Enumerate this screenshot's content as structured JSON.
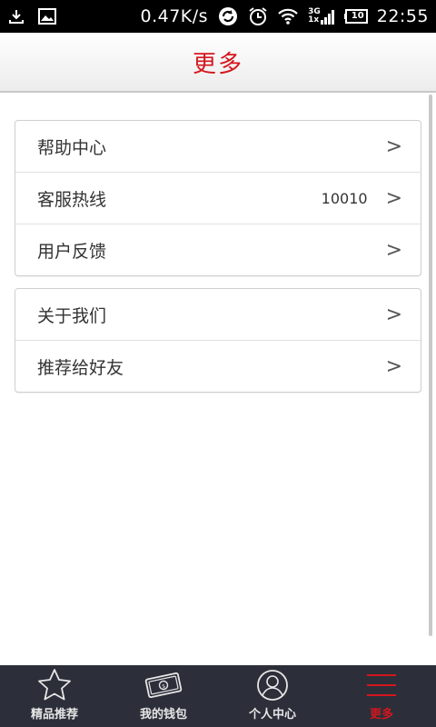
{
  "statusbar": {
    "speed": "0.47K/s",
    "network": "3G",
    "network_sub": "1x",
    "battery": "10",
    "time": "22:55"
  },
  "header": {
    "title": "更多"
  },
  "groups": [
    {
      "items": [
        {
          "label": "帮助中心",
          "value": "",
          "arrow": ">"
        },
        {
          "label": "客服热线",
          "value": "10010",
          "arrow": ">"
        },
        {
          "label": "用户反馈",
          "value": "",
          "arrow": ">"
        }
      ]
    },
    {
      "items": [
        {
          "label": "关于我们",
          "value": "",
          "arrow": ">"
        },
        {
          "label": "推荐给好友",
          "value": "",
          "arrow": ">"
        }
      ]
    }
  ],
  "bottom_nav": [
    {
      "label": "精品推荐",
      "icon": "star-icon"
    },
    {
      "label": "我的钱包",
      "icon": "wallet-icon"
    },
    {
      "label": "个人中心",
      "icon": "user-icon"
    },
    {
      "label": "更多",
      "icon": "menu-icon",
      "active": true
    }
  ],
  "colors": {
    "accent": "#d4161d",
    "nav_bg": "#2c2f3a"
  }
}
